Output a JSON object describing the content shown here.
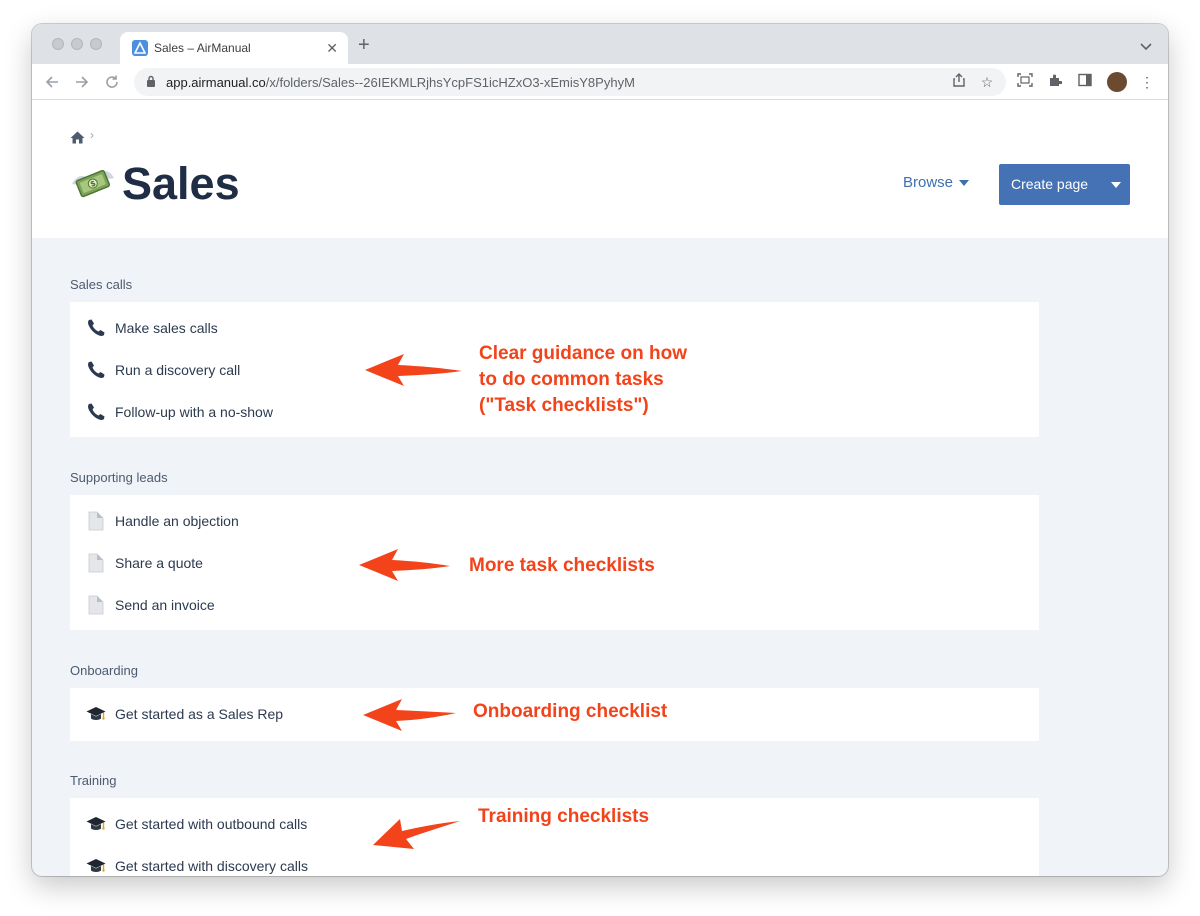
{
  "browser": {
    "tab_title": "Sales – AirManual",
    "url_host": "app.airmanual.co",
    "url_path": "/x/folders/Sales--26IEKMLRjhsYcpFS1icHZxO3-xEmisY8PyhyM"
  },
  "header": {
    "breadcrumb_sep": "›",
    "title": "Sales",
    "browse_label": "Browse",
    "create_label": "Create page"
  },
  "sections": [
    {
      "label": "Sales calls",
      "items": [
        "Make sales calls",
        "Run a discovery call",
        "Follow-up with a no-show"
      ],
      "icon": "phone-icon"
    },
    {
      "label": "Supporting leads",
      "items": [
        "Handle an objection",
        "Share a quote",
        "Send an invoice"
      ],
      "icon": "document-icon"
    },
    {
      "label": "Onboarding",
      "items": [
        "Get started as a Sales Rep"
      ],
      "icon": "graduation-cap-icon"
    },
    {
      "label": "Training",
      "items": [
        "Get started with outbound calls",
        "Get started with discovery calls"
      ],
      "icon": "graduation-cap-icon"
    }
  ],
  "annotations": {
    "task_line1": "Clear guidance on how",
    "task_line2": "to do common tasks",
    "task_line3": "(\"Task checklists\")",
    "more": "More task checklists",
    "onboarding": "Onboarding checklist",
    "training": "Training checklists"
  },
  "colors": {
    "accent": "#4472b5",
    "annotation": "#f2431b",
    "title": "#1f2d45",
    "page_bg": "#f0f3f7"
  }
}
